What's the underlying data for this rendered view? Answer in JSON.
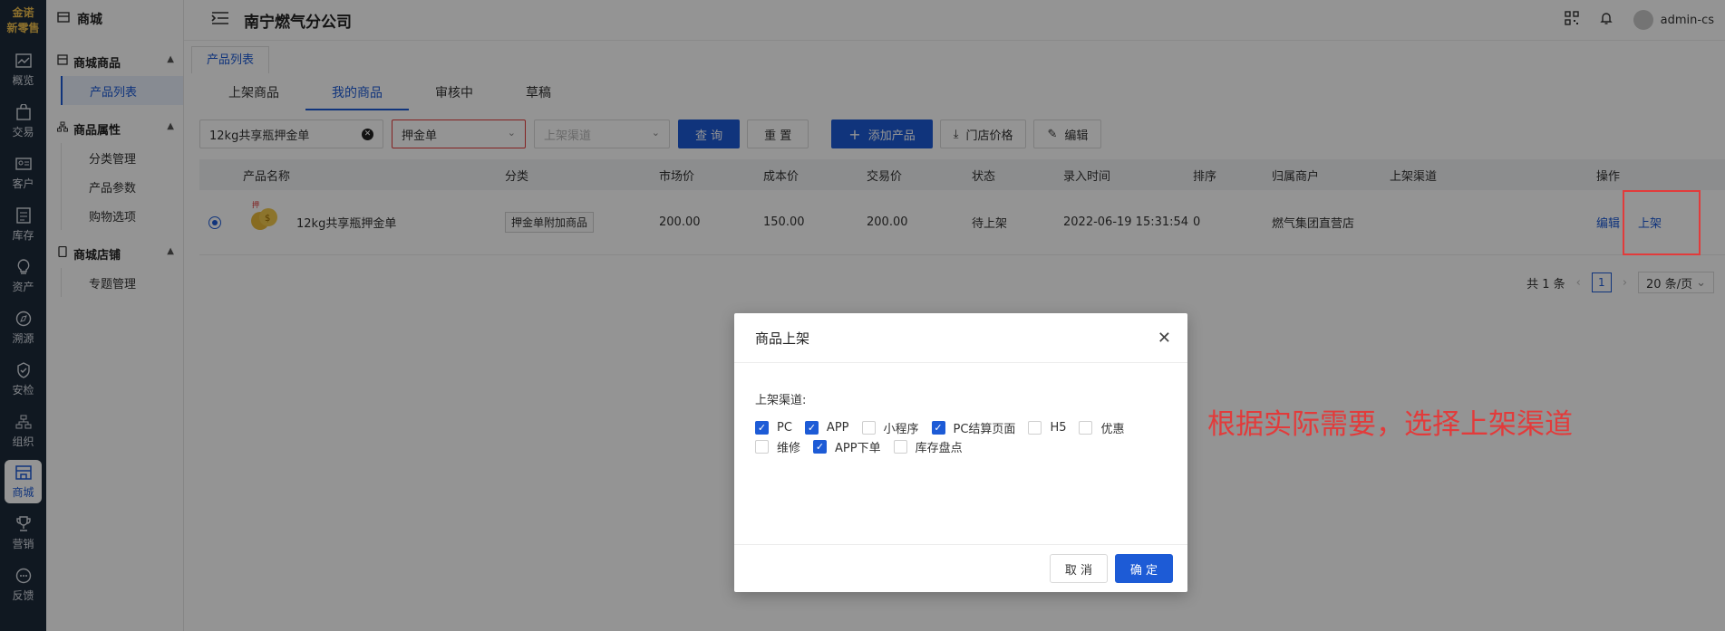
{
  "logo": {
    "line1": "金诺",
    "line2": "新零售"
  },
  "rail": [
    {
      "label": "概览",
      "icon": "chart-icon"
    },
    {
      "label": "交易",
      "icon": "bag-icon"
    },
    {
      "label": "客户",
      "icon": "id-card-icon"
    },
    {
      "label": "库存",
      "icon": "list-icon"
    },
    {
      "label": "资产",
      "icon": "bulb-icon"
    },
    {
      "label": "溯源",
      "icon": "compass-icon"
    },
    {
      "label": "安检",
      "icon": "shield-icon"
    },
    {
      "label": "组织",
      "icon": "org-icon"
    },
    {
      "label": "商城",
      "icon": "store-icon"
    },
    {
      "label": "营销",
      "icon": "trophy-icon"
    },
    {
      "label": "反馈",
      "icon": "chat-icon"
    }
  ],
  "sidebar": {
    "title": "商城",
    "groups": [
      {
        "label": "商城商品",
        "items": [
          "产品列表"
        ]
      },
      {
        "label": "商品属性",
        "items": [
          "分类管理",
          "产品参数",
          "购物选项"
        ]
      },
      {
        "label": "商城店铺",
        "items": [
          "专题管理"
        ]
      }
    ]
  },
  "header": {
    "title": "南宁燃气分公司",
    "user": "admin-cs"
  },
  "page_tab": "产品列表",
  "subtabs": [
    "上架商品",
    "我的商品",
    "审核中",
    "草稿"
  ],
  "filters": {
    "search_value": "12kg共享瓶押金单",
    "category_value": "押金单",
    "channel_placeholder": "上架渠道",
    "query": "查 询",
    "reset": "重 置",
    "add": "添加产品",
    "store_price": "门店价格",
    "edit": "编辑"
  },
  "table": {
    "headers": [
      "产品名称",
      "分类",
      "市场价",
      "成本价",
      "交易价",
      "状态",
      "录入时间",
      "排序",
      "归属商户",
      "上架渠道",
      "操作"
    ],
    "row": {
      "name": "12kg共享瓶押金单",
      "category": "押金单附加商品",
      "market_price": "200.00",
      "cost_price": "150.00",
      "trade_price": "200.00",
      "status": "待上架",
      "created": "2022-06-19 15:31:54",
      "sort": "0",
      "merchant": "燃气集团直营店",
      "channels": "",
      "action_edit": "编辑",
      "action_shelf": "上架"
    }
  },
  "pager": {
    "total": "共 1 条",
    "page": "1",
    "size": "20 条/页"
  },
  "modal": {
    "title": "商品上架",
    "label": "上架渠道:",
    "options_row1": [
      {
        "label": "PC",
        "checked": true
      },
      {
        "label": "APP",
        "checked": true
      },
      {
        "label": "小程序",
        "checked": false
      },
      {
        "label": "PC结算页面",
        "checked": true
      },
      {
        "label": "H5",
        "checked": false
      },
      {
        "label": "优惠",
        "checked": false
      }
    ],
    "options_row2": [
      {
        "label": "维修",
        "checked": false
      },
      {
        "label": "APP下单",
        "checked": true
      },
      {
        "label": "库存盘点",
        "checked": false
      }
    ],
    "cancel": "取 消",
    "confirm": "确 定"
  },
  "annotation": "根据实际需要，选择上架渠道",
  "colors": {
    "primary": "#1d5bd6",
    "annotation": "#e23b3b",
    "rail": "#1d2a3a"
  }
}
